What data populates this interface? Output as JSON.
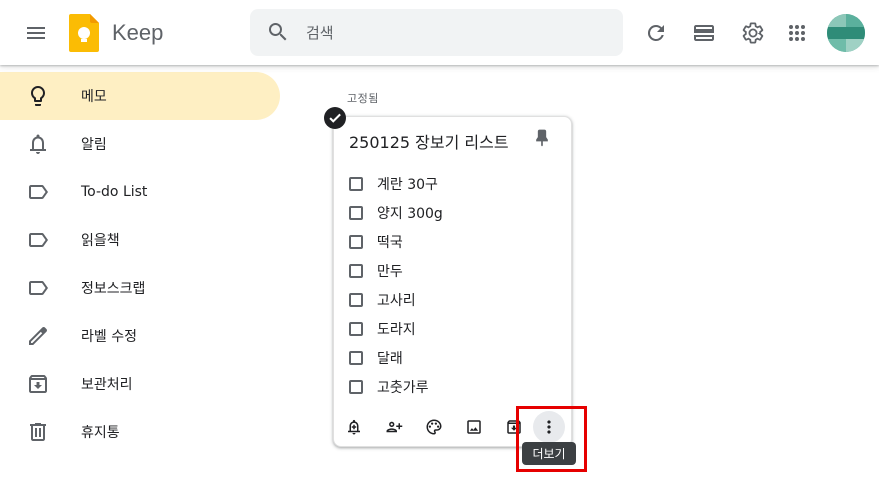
{
  "header": {
    "app_title": "Keep",
    "search_placeholder": "검색"
  },
  "sidebar": {
    "items": [
      {
        "label": "메모",
        "icon": "lightbulb-icon",
        "active": true
      },
      {
        "label": "알림",
        "icon": "bell-icon",
        "active": false
      },
      {
        "label": "To-do List",
        "icon": "label-icon",
        "active": false
      },
      {
        "label": "읽을책",
        "icon": "label-icon",
        "active": false
      },
      {
        "label": "정보스크랩",
        "icon": "label-icon",
        "active": false
      },
      {
        "label": "라벨 수정",
        "icon": "pencil-icon",
        "active": false
      },
      {
        "label": "보관처리",
        "icon": "archive-icon",
        "active": false
      },
      {
        "label": "휴지통",
        "icon": "trash-icon",
        "active": false
      }
    ]
  },
  "main": {
    "section_label": "고정됨",
    "note": {
      "title": "250125 장보기 리스트",
      "items": [
        "계란 30구",
        "양지 300g",
        "떡국",
        "만두",
        "고사리",
        "도라지",
        "달래",
        "고춧가루"
      ]
    },
    "tooltip": "더보기"
  },
  "colors": {
    "active_nav": "#feefc3",
    "highlight": "#e60000",
    "keep_yellow": "#fbbc04"
  }
}
